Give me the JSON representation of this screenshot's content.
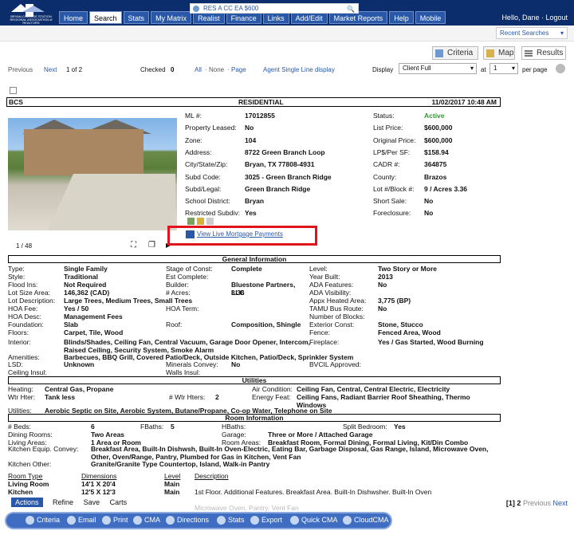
{
  "app": {
    "logo_text": "BRYAN-COLLEGE STATION REGIONAL ASSOCIATION of REALTORS",
    "greeting": "Hello, Dane · Logout"
  },
  "nav": [
    "Home",
    "Search",
    "Stats",
    "My Matrix",
    "Realist",
    "Finance",
    "Links",
    "Add/Edit",
    "Market Reports",
    "Help",
    "Mobile"
  ],
  "search": {
    "current": "RES A CC EA $600",
    "recent": "Recent Searches"
  },
  "view_tabs": {
    "criteria": "Criteria",
    "map": "Map",
    "results": "Results"
  },
  "pager": {
    "previous": "Previous",
    "next": "Next",
    "position": "1 of 2",
    "checked_label": "Checked",
    "checked_count": "0",
    "all": "All",
    "none": "None",
    "page": "Page",
    "agent_link": "Agent Single Line display",
    "display_label": "Display",
    "display_value": "Client Full",
    "at_label": "at",
    "at_value": "1",
    "per_page": "per page"
  },
  "listing": {
    "header": {
      "left": "BCS",
      "center": "RESIDENTIAL",
      "right": "11/02/2017  10:48 AM"
    },
    "photo_counter": "1 / 48",
    "mortgage_link": "View Live Mortgage Payments",
    "left": [
      [
        "ML #:",
        "17012855"
      ],
      [
        "Property Leased:",
        "No"
      ],
      [
        "Zone:",
        "104"
      ],
      [
        "Address:",
        "8722 Green Branch Loop"
      ],
      [
        "City/State/Zip:",
        "Bryan, TX 77808-4931"
      ],
      [
        "Subd Code:",
        "3025 - Green Branch Ridge"
      ],
      [
        "Subd/Legal:",
        "Green Branch Ridge"
      ],
      [
        "School District:",
        "Bryan"
      ],
      [
        "Restricted Subdiv:",
        "Yes"
      ]
    ],
    "right": [
      [
        "Status:",
        "Active"
      ],
      [
        "List Price:",
        "$600,000"
      ],
      [
        "Original Price:",
        "$600,000"
      ],
      [
        "LP$/Per SF:",
        "$158.94"
      ],
      [
        "CADR #:",
        "364875"
      ],
      [
        "County:",
        "Brazos"
      ],
      [
        "Lot #/Block #:",
        "9 / Acres 3.36"
      ],
      [
        "Short Sale:",
        "No"
      ],
      [
        "Foreclosure:",
        "No"
      ]
    ],
    "status_color": "#2e9a2e"
  },
  "sections": {
    "general": "General Information",
    "utilities": "Utilities",
    "rooms": "Room Information"
  },
  "general": [
    [
      "Type:",
      "Single Family",
      "Stage of Const:",
      "Complete",
      "Level:",
      "Two Story or More"
    ],
    [
      "Style:",
      "Traditional",
      "Est Complete:",
      "",
      "Year Built:",
      "2013"
    ],
    [
      "Flood Ins:",
      "Not Required",
      "Builder:",
      "Bluestone Partners, LLC",
      "ADA Features:",
      "No"
    ],
    [
      "Lot Size Area:",
      "146,362 (CAD)",
      "# Acres:",
      "3.36",
      "ADA Visibility:",
      ""
    ],
    [
      "Lot Description:",
      "Large Trees, Medium Trees, Small Trees",
      "",
      "",
      "Appx Heated Area:",
      "3,775 (BP)"
    ],
    [
      "HOA Fee:",
      "Yes / 50",
      "HOA Term:",
      "",
      "TAMU Bus Route:",
      "No"
    ],
    [
      "HOA Desc:",
      "Management Fees",
      "",
      "",
      "Number of Blocks:",
      ""
    ],
    [
      "Foundation:",
      "Slab",
      "Roof:",
      "Composition, Shingle",
      "Exterior Const:",
      "Stone, Stucco"
    ],
    [
      "Floors:",
      "Carpet, Tile, Wood",
      "",
      "",
      "Fence:",
      "Fenced Area, Wood"
    ]
  ],
  "interior": {
    "label": "Interior:",
    "value": "Blinds/Shades, Ceiling Fan, Central Vacuum, Garage Door Opener, Intercom, Raised Ceiling, Security System, Smoke Alarm",
    "fp_label": "Fireplace:",
    "fp_value": "Yes / Gas Started, Wood Burning"
  },
  "amenities": {
    "label": "Amenities:",
    "value": "Barbecues, BBQ Grill, Covered Patio/Deck, Outside Kitchen, Patio/Deck, Sprinkler System"
  },
  "misc": [
    [
      "LSD:",
      "Unknown",
      "Minerals Convey:",
      "No",
      "BVCIL Approved:",
      ""
    ],
    [
      "Ceiling Insul:",
      "",
      "Walls Insul:",
      "",
      "",
      ""
    ]
  ],
  "utilities": [
    [
      "Heating:",
      "Central Gas, Propane",
      "Air Condition:",
      "Ceiling Fan, Central, Central Electric, Electricity"
    ],
    [
      "Wtr Hter:",
      "Tank less",
      "# Wtr Hters:",
      "2",
      "Energy Feat:",
      "Ceiling Fans, Radiant Barrier Roof Sheathing, Thermo Windows"
    ]
  ],
  "utilities_line": {
    "label": "Utilities:",
    "value": "Aerobic Septic on Site, Aerobic System, Butane/Propane, Co-op Water, Telephone on Site"
  },
  "rooms": [
    [
      "# Beds:",
      "6",
      "FBaths:",
      "5",
      "HBaths:",
      "",
      "Split Bedroom:",
      "Yes"
    ],
    [
      "Dining Rooms:",
      "Two Areas",
      "",
      "",
      "Garage:",
      "Three or More / Attached Garage",
      "",
      ""
    ],
    [
      "Living Areas:",
      "1 Area or Room",
      "",
      "",
      "Room Areas:",
      "Breakfast Room, Formal Dining, Formal Living, Kit/Din Combo",
      "",
      ""
    ]
  ],
  "kitchen": {
    "label": "Kitchen Equip. Convey:",
    "value": "Breakfast Area, Built-In Dishwsh, Built-In Oven-Electric, Eating Bar, Garbage Disposal, Gas Range, Island, Microwave Oven, Other, Oven/Range, Pantry, Plumbed for Gas in Kitchen, Vent Fan"
  },
  "kitchen_other": {
    "label": "Kitchen Other:",
    "value": "Granite/Granite Type Countertop, Island, Walk-in Pantry"
  },
  "room_table": {
    "headers": [
      "Room Type",
      "Dimensions",
      "Level",
      "Description"
    ],
    "rows": [
      [
        "Living Room",
        "14'1 X 20'4",
        "Main",
        ""
      ],
      [
        "Kitchen",
        "12'5 X 12'3",
        "Main",
        "1st Floor. Additional Features. Breakfast Area. Built-In Dishwsher. Built-In Oven"
      ]
    ]
  },
  "ghost_text": "Microwave Oven, Pantry, Vent Fan",
  "bottom_tabs": [
    "Actions",
    "Refine",
    "Save",
    "Carts"
  ],
  "bottom_pager": {
    "pages": "[1] 2",
    "prev": "Previous",
    "next": "Next"
  },
  "toolbar": [
    "Criteria",
    "Email",
    "Print",
    "CMA",
    "Directions",
    "Stats",
    "Export",
    "Quick CMA",
    "CloudCMA"
  ],
  "colors": {
    "nav_bg": "#0c2d6b",
    "nav_btn": "#2a58a8",
    "link": "#2a58a8",
    "highlight_box": "#e0141b",
    "toolbar": "#3f6dc1"
  }
}
